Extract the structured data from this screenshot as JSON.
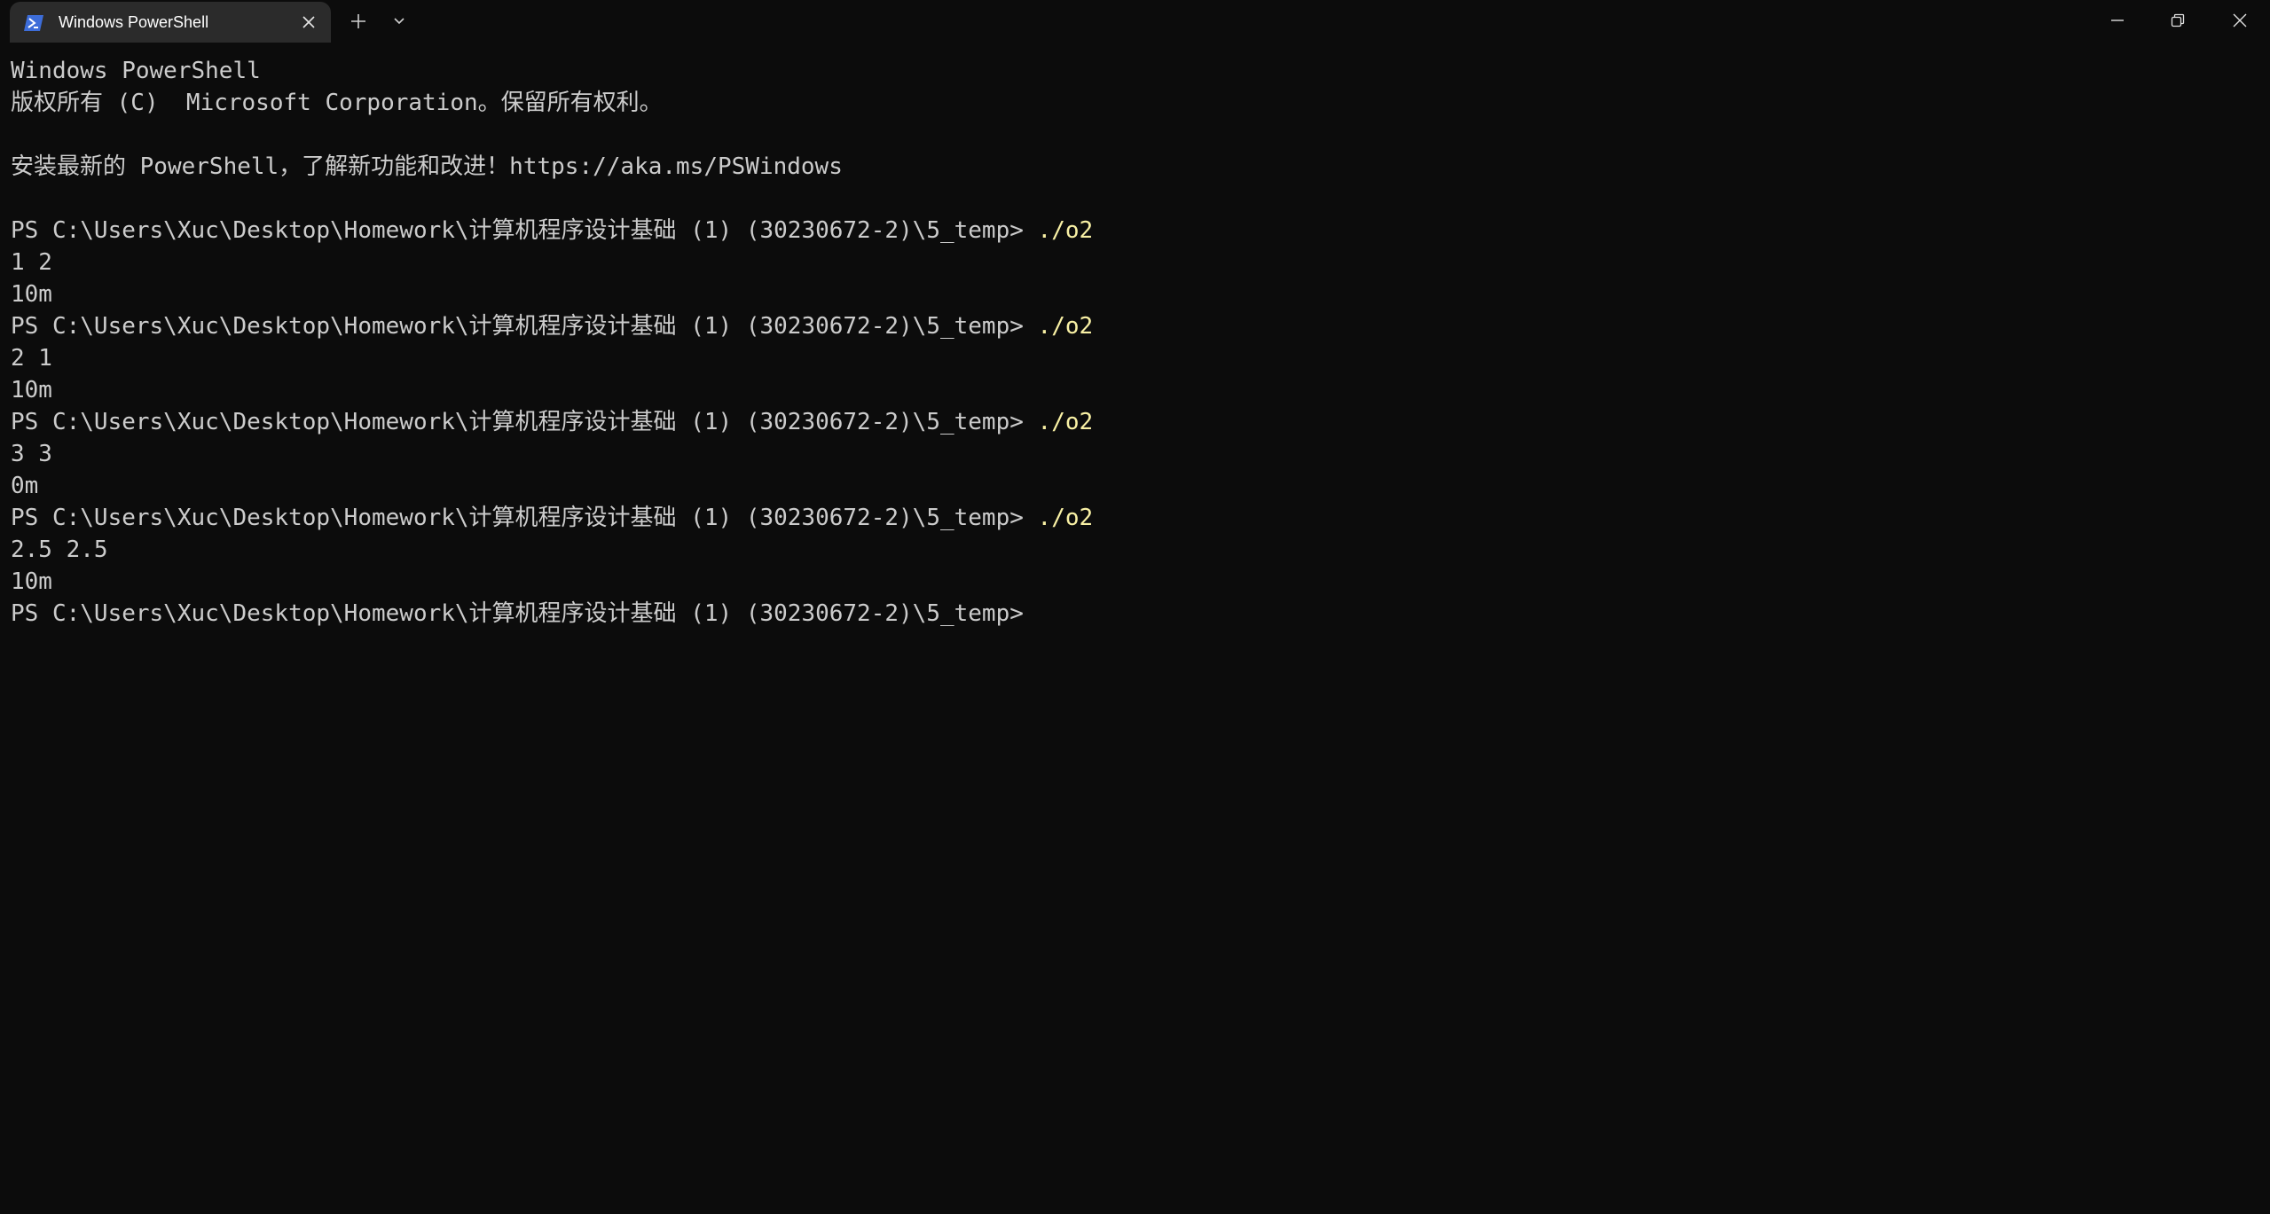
{
  "window": {
    "tab_title": "Windows PowerShell",
    "tab_icon": "powershell-icon",
    "new_tab_icon": "plus-icon",
    "dropdown_icon": "chevron-down-icon",
    "minimize_icon": "minimize-icon",
    "maximize_icon": "restore-icon",
    "close_icon": "close-icon",
    "colors": {
      "background": "#0c0c0c",
      "tab_background": "#2b2b2b",
      "text": "#cccccc",
      "command": "#f9f1a5",
      "icon_blue": "#3d6dd9"
    }
  },
  "terminal": {
    "header": [
      "Windows PowerShell",
      "版权所有 (C)  Microsoft Corporation。保留所有权利。",
      "",
      "安装最新的 PowerShell，了解新功能和改进！https://aka.ms/PSWindows",
      ""
    ],
    "prompt": "PS C:\\Users\\Xuc\\Desktop\\Homework\\计算机程序设计基础 (1) (30230672-2)\\5_temp> ",
    "runs": [
      {
        "command": "./o2",
        "output": [
          "1 2",
          "10m"
        ]
      },
      {
        "command": "./o2",
        "output": [
          "2 1",
          "10m"
        ]
      },
      {
        "command": "./o2",
        "output": [
          "3 3",
          "0m"
        ]
      },
      {
        "command": "./o2",
        "output": [
          "2.5 2.5",
          "10m"
        ]
      }
    ],
    "final_prompt": "PS C:\\Users\\Xuc\\Desktop\\Homework\\计算机程序设计基础 (1) (30230672-2)\\5_temp>"
  }
}
